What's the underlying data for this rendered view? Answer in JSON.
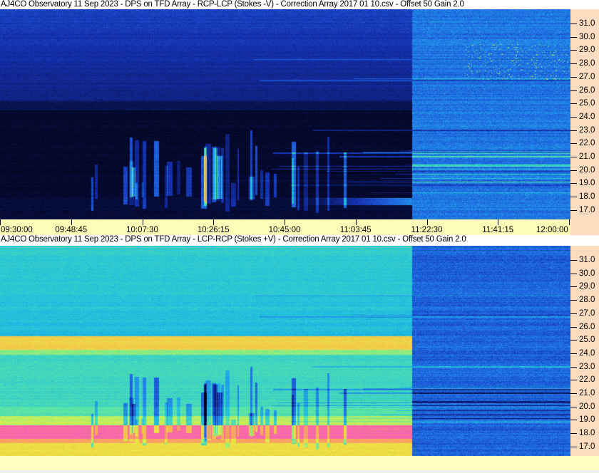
{
  "chart_data": [
    {
      "type": "heatmap",
      "title": "AJ4CO Observatory 11 Sep 2023 -  DPS on TFD Array  -  RCP-LCP (Stokes -V)  -  Correction Array 2017 01 10.csv  -  Offset 50  Gain 2.0",
      "x_ticks": [
        "09:30:00",
        "09:48:45",
        "10:07:30",
        "10:26:15",
        "10:45:00",
        "11:03:45",
        "11:22:30",
        "11:41:15",
        "12:00:00"
      ],
      "y_ticks": [
        "31.0",
        "30.0",
        "29.0",
        "28.0",
        "27.0",
        "26.0",
        "25.0",
        "24.0",
        "23.0",
        "22.0",
        "21.0",
        "20.0",
        "19.0",
        "18.0",
        "17.0"
      ],
      "y_axis_side": "right",
      "colormap": [
        "#000010",
        "#0a1450",
        "#1530b0",
        "#2070e8",
        "#20c0e0",
        "#60e8a0",
        "#e8f040",
        "#f8b050",
        "#f870a0",
        "#f040f0"
      ]
    },
    {
      "type": "heatmap",
      "title": "AJ4CO Observatory 11 Sep 2023 -  DPS on TFD Array  -  LCP-RCP (Stokes +V)  -  Correction Array 2017 01 10.csv  -  Offset 50  Gain 2.0",
      "y_ticks": [
        "31.0",
        "30.0",
        "29.0",
        "28.0",
        "27.0",
        "26.0",
        "25.0",
        "24.0",
        "23.0",
        "22.0",
        "21.0",
        "20.0",
        "19.0",
        "18.0",
        "17.0"
      ],
      "y_axis_side": "right",
      "colormap": [
        "#000010",
        "#0a1450",
        "#1530b0",
        "#2070e8",
        "#20c0e0",
        "#60e8a0",
        "#e8f040",
        "#f8b050",
        "#f870a0",
        "#f040f0"
      ]
    }
  ]
}
